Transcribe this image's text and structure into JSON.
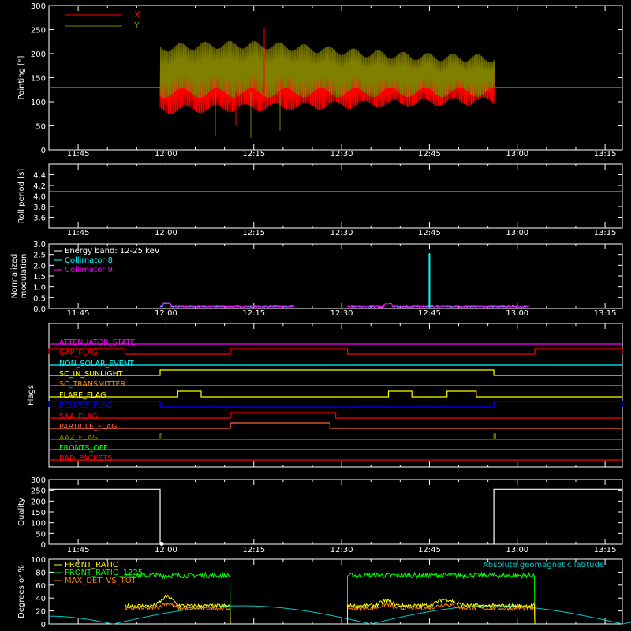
{
  "x_tick_labels": [
    "11:45",
    "12:00",
    "12:15",
    "12:30",
    "12:45",
    "13:00",
    "13:15"
  ],
  "chart_data": [
    {
      "type": "line",
      "panel": "pointing",
      "ylabel": "Pointing [\"]",
      "ylim": [
        0,
        300
      ],
      "yticks": [
        0,
        50,
        100,
        150,
        200,
        250,
        300
      ],
      "x_range": [
        "11:40",
        "13:26"
      ],
      "legend": "top-left",
      "reference_line": 130,
      "series": [
        {
          "name": "X",
          "color": "#ff0000",
          "x_start": "11:59",
          "x_end": "12:56",
          "approx_band": [
            80,
            200
          ],
          "spikes": [
            30,
            45,
            230
          ]
        },
        {
          "name": "Y",
          "color": "#808000",
          "x_start": "11:59",
          "x_end": "12:56",
          "approx_band": [
            115,
            225
          ],
          "spikes": [
            25,
            260
          ]
        }
      ]
    },
    {
      "type": "line",
      "panel": "roll-period",
      "ylabel": "Roll period [s]",
      "ylim": [
        3.4,
        4.6
      ],
      "yticks": [
        3.6,
        3.8,
        4.0,
        4.2,
        4.4
      ],
      "series": [
        {
          "name": "",
          "color": "#ffffff",
          "x": [
            "11:40",
            "13:26"
          ],
          "values": [
            4.08,
            4.08
          ]
        }
      ]
    },
    {
      "type": "line",
      "panel": "modulation",
      "ylabel_lines": [
        "Normalized",
        "modulation"
      ],
      "ylim": [
        0,
        3.0
      ],
      "yticks": [
        0.0,
        0.5,
        1.0,
        1.5,
        2.0,
        2.5,
        3.0
      ],
      "legend_note": "Energy band: 12-25 keV",
      "series": [
        {
          "name": "Collimator 8",
          "color": "#00ffff",
          "segments": [
            [
              "11:59",
              "12:22"
            ],
            [
              "12:31",
              "13:02"
            ]
          ],
          "spike": {
            "x": "12:45",
            "value": 2.55
          }
        },
        {
          "name": "Collimator 9",
          "color": "#ff00ff",
          "segments": [
            [
              "11:59",
              "12:22"
            ],
            [
              "12:31",
              "13:02"
            ]
          ]
        }
      ]
    },
    {
      "type": "line",
      "panel": "flags",
      "ylabel": "Flags",
      "flags": [
        {
          "label": "ATTENUATOR_STATE",
          "color": "#ff00ff",
          "high": []
        },
        {
          "label": "GAP_FLAG",
          "color": "#ff0000",
          "high": [
            [
              "11:40",
              "11:53"
            ],
            [
              "12:11",
              "12:31"
            ],
            [
              "13:03",
              "13:26"
            ]
          ]
        },
        {
          "label": "NON_SOLAR_EVENT",
          "color": "#00ffff",
          "high": []
        },
        {
          "label": "SC_IN_SUNLIGHT",
          "color": "#ffff00",
          "high": [
            [
              "11:59",
              "12:56"
            ]
          ]
        },
        {
          "label": "SC_TRANSMITTER",
          "color": "#ff8000",
          "high": []
        },
        {
          "label": "FLARE_FLAG",
          "color": "#ffff00",
          "high": [
            [
              "12:02",
              "12:06"
            ],
            [
              "12:38",
              "12:42"
            ],
            [
              "12:48",
              "12:53"
            ]
          ]
        },
        {
          "label": "ECLIPSE_FLAG",
          "color": "#0000ff",
          "high": [
            [
              "11:40",
              "11:59"
            ],
            [
              "12:56",
              "13:26"
            ]
          ]
        },
        {
          "label": "SAA_FLAG",
          "color": "#ff0000",
          "high": [
            [
              "12:11",
              "12:29"
            ]
          ]
        },
        {
          "label": "PARTICLE_FLAG",
          "color": "#ff6040",
          "high": [
            [
              "12:11",
              "12:28"
            ]
          ]
        },
        {
          "label": "AAZ_FLAG",
          "color": "#808000",
          "high": [
            [
              "11:59",
              "11:59.3"
            ],
            [
              "12:56",
              "12:56.3"
            ]
          ]
        },
        {
          "label": "FRONTS_OFF",
          "color": "#00ff00",
          "high": []
        },
        {
          "label": "BAD_PACKETS",
          "color": "#ff0000",
          "high": []
        }
      ]
    },
    {
      "type": "line",
      "panel": "quality",
      "ylabel": "Quality",
      "ylim": [
        0,
        300
      ],
      "yticks": [
        0,
        50,
        100,
        150,
        200,
        250,
        300
      ],
      "series": [
        {
          "name": "",
          "color": "#ffffff",
          "segments": [
            {
              "x": [
                "11:40",
                "11:59",
                "11:59"
              ],
              "values": [
                255,
                255,
                0
              ]
            },
            {
              "x": [
                "12:56",
                "12:56",
                "13:26"
              ],
              "values": [
                0,
                255,
                255
              ]
            }
          ]
        }
      ]
    },
    {
      "type": "line",
      "panel": "ratios",
      "ylabel": "Degrees or %",
      "ylim": [
        0,
        100
      ],
      "yticks": [
        0,
        20,
        40,
        60,
        80,
        100
      ],
      "series": [
        {
          "name": "FRONT_RATIO",
          "color": "#ffff00",
          "segments": [
            [
              "11:53",
              "12:11"
            ],
            [
              "12:31",
              "13:03"
            ]
          ],
          "level": 28
        },
        {
          "name": "FRONT_RATIO_1225",
          "color": "#00ff00",
          "segments": [
            [
              "11:53",
              "12:11"
            ],
            [
              "12:31",
              "13:03"
            ]
          ],
          "level": 75
        },
        {
          "name": "MAX_DET_VS_TOT",
          "color": "#ff8000",
          "segments": [
            [
              "11:53",
              "12:11"
            ],
            [
              "12:31",
              "13:03"
            ]
          ],
          "level": 24
        },
        {
          "name": "Absolute geomagnetic latitude",
          "color": "#00c8c8",
          "type": "curve",
          "x": [
            "11:40",
            "11:51",
            "12:13",
            "12:35",
            "12:56",
            "13:18",
            "13:26"
          ],
          "values": [
            12,
            0,
            28,
            0,
            28,
            0,
            9
          ]
        }
      ]
    }
  ]
}
